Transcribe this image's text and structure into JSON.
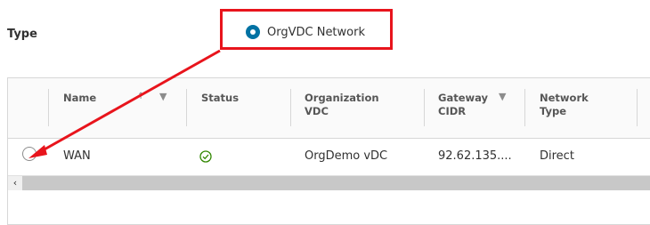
{
  "form": {
    "type_label": "Type",
    "selected_option": "OrgVDC Network"
  },
  "grid": {
    "columns": [
      "Name",
      "Status",
      "Organization VDC",
      "Gateway CIDR",
      "Network Type"
    ],
    "column_lines": {
      "organization_vdc": [
        "Organization",
        "VDC"
      ],
      "gateway_cidr": [
        "Gateway",
        "CIDR"
      ],
      "network_type": [
        "Network",
        "Type"
      ]
    },
    "rows": [
      {
        "name": "WAN",
        "status": "ok",
        "organization_vdc": "OrgDemo vDC",
        "gateway_cidr": "92.62.135....",
        "network_type": "Direct"
      }
    ],
    "scroll_left_glyph": "‹"
  },
  "colors": {
    "accent": "#0072a3",
    "highlight": "#e8141c",
    "status_ok": "#318700"
  }
}
